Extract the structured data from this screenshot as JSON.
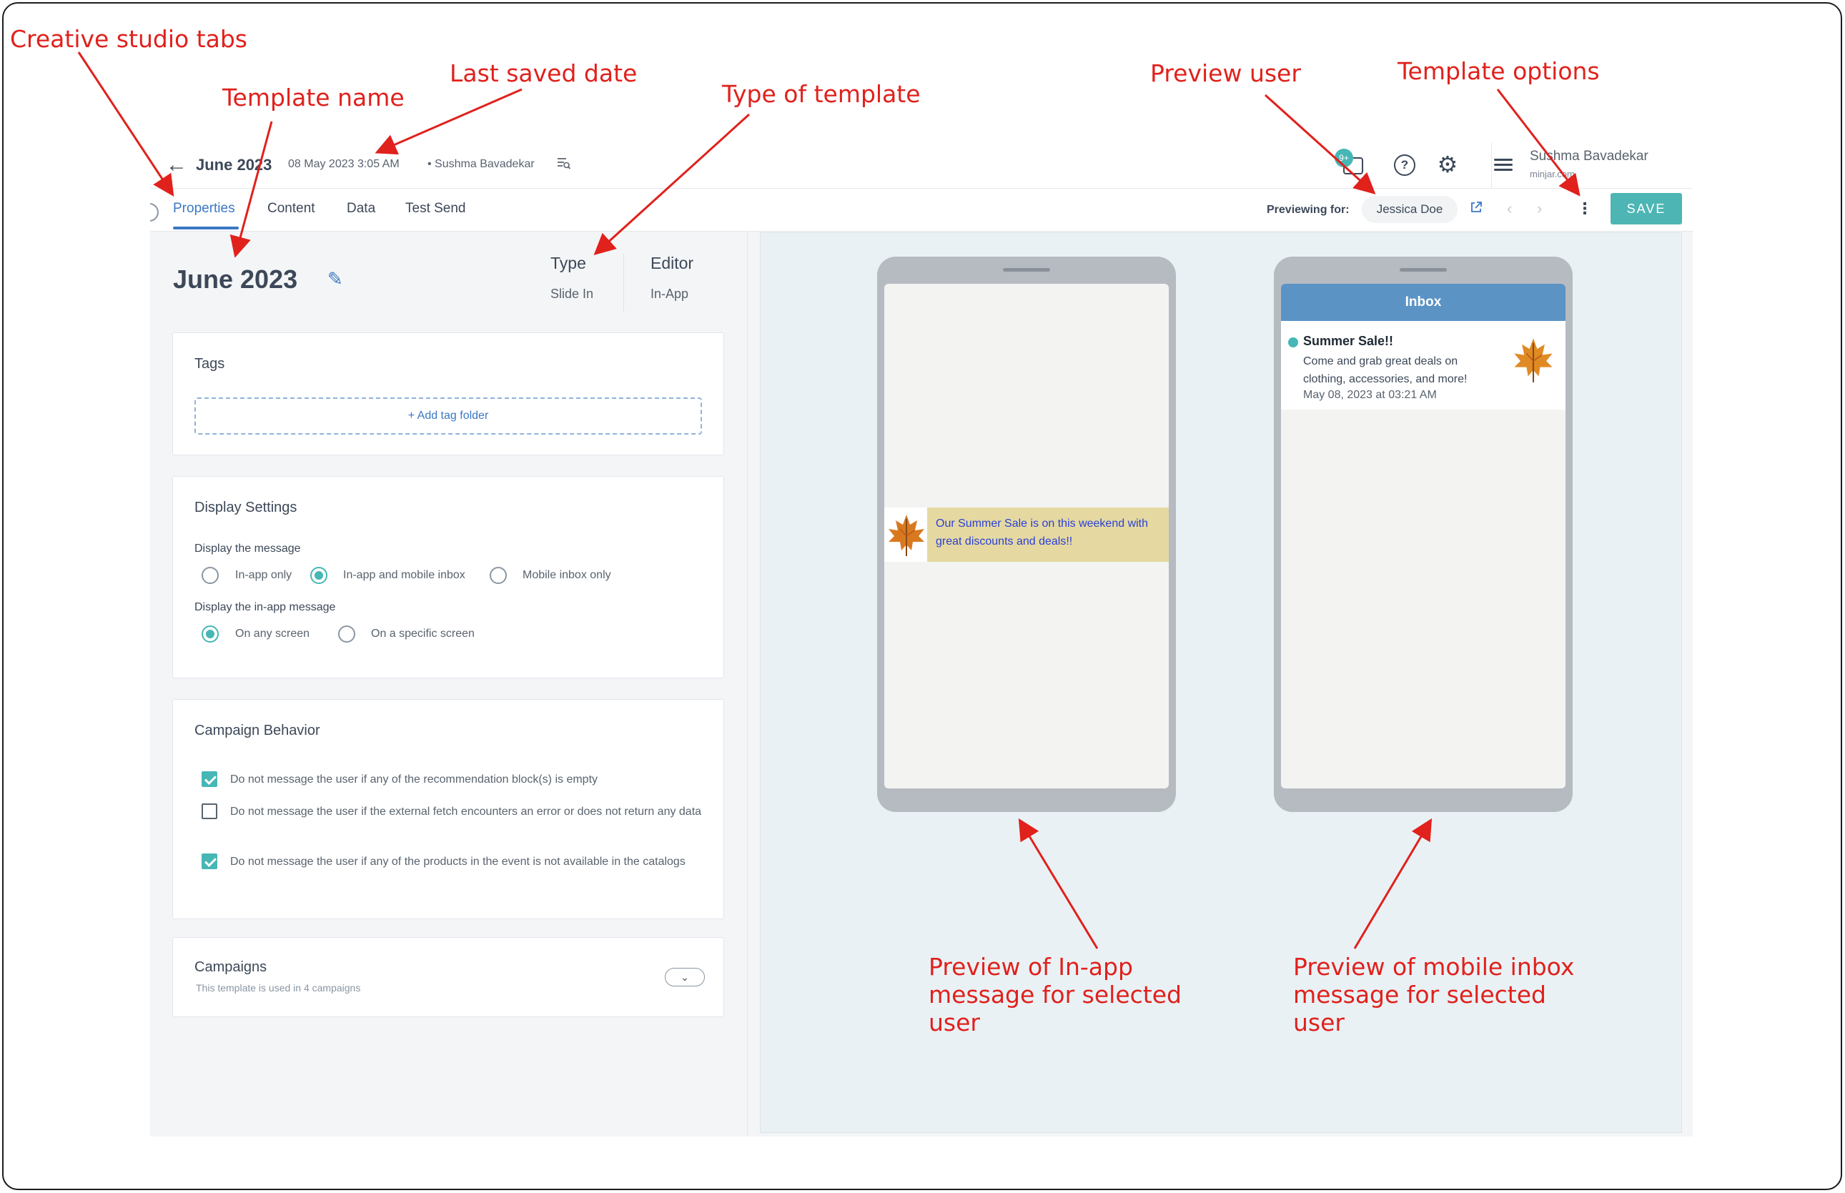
{
  "header": {
    "title": "June 2023",
    "saved_date": "08 May 2023 3:05 AM",
    "saved_by": "• Sushma Bavadekar",
    "notif_badge": "9+",
    "help_glyph": "?",
    "user_name": "Sushma Bavadekar",
    "user_org": "minjar.com"
  },
  "tabs": [
    {
      "label": "Properties",
      "active": true
    },
    {
      "label": "Content"
    },
    {
      "label": "Data"
    },
    {
      "label": "Test Send"
    }
  ],
  "preview_bar": {
    "label": "Previewing for:",
    "user": "Jessica Doe",
    "save_label": "SAVE"
  },
  "properties": {
    "name": "June 2023",
    "type_label": "Type",
    "type_value": "Slide In",
    "editor_label": "Editor",
    "editor_value": "In-App"
  },
  "tags": {
    "title": "Tags",
    "add_label": "+ Add tag folder"
  },
  "display_settings": {
    "title": "Display Settings",
    "message_label": "Display the message",
    "message_options": [
      "In-app only",
      "In-app and mobile inbox",
      "Mobile inbox only"
    ],
    "message_selected": "In-app and mobile inbox",
    "inapp_label": "Display the in-app message",
    "inapp_options": [
      "On any screen",
      "On a specific screen"
    ],
    "inapp_selected": "On any screen"
  },
  "campaign_behavior": {
    "title": "Campaign Behavior",
    "options": [
      {
        "label": "Do not message the user if any of the recommendation block(s) is empty",
        "checked": true
      },
      {
        "label": "Do not message the user if the external fetch encounters an error or does not return any data",
        "checked": false
      },
      {
        "label": "Do not message the user if any of the products in the event is not available in the catalogs",
        "checked": true
      }
    ]
  },
  "campaigns": {
    "title": "Campaigns",
    "subtitle": "This template is used in 4 campaigns"
  },
  "inapp_preview": {
    "message": "Our Summer Sale is on this weekend with great discounts and deals!!"
  },
  "inbox_preview": {
    "header": "Inbox",
    "title": "Summer Sale!!",
    "body": "Come and grab great deals on clothing, accessories, and more!",
    "date": "May 08, 2023 at 03:21 AM"
  },
  "annotations": {
    "creative_studio_tabs": "Creative studio tabs",
    "template_name": "Template name",
    "last_saved_date": "Last saved date",
    "type_of_template": "Type of template",
    "preview_user": "Preview user",
    "template_options": "Template options",
    "preview_inapp": "Preview of In-app message for selected user",
    "preview_inbox": "Preview of mobile inbox message for selected user"
  },
  "colors": {
    "accent": "#3b78c4",
    "teal": "#46b7b5",
    "annotation": "#e0211c",
    "slide_bg": "#e5d9a1",
    "inbox_header": "#5b93c5"
  }
}
